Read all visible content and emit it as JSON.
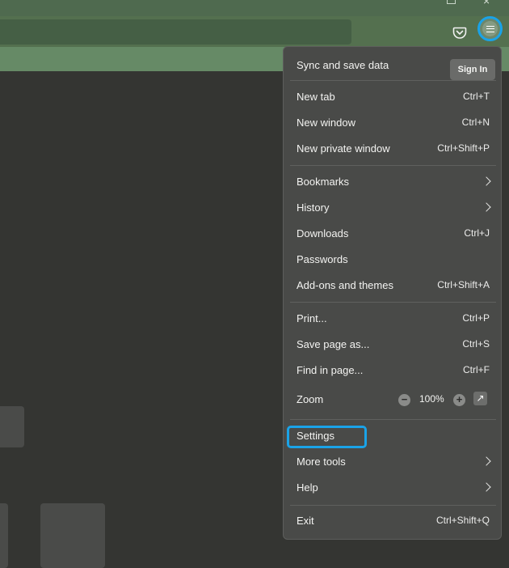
{
  "menu": {
    "sync_label": "Sync and save data",
    "sign_in": "Sign In",
    "items_group1": [
      {
        "label": "New tab",
        "shortcut": "Ctrl+T"
      },
      {
        "label": "New window",
        "shortcut": "Ctrl+N"
      },
      {
        "label": "New private window",
        "shortcut": "Ctrl+Shift+P"
      }
    ],
    "items_group2": [
      {
        "label": "Bookmarks",
        "shortcut": ""
      },
      {
        "label": "History",
        "shortcut": ""
      },
      {
        "label": "Downloads",
        "shortcut": "Ctrl+J"
      },
      {
        "label": "Passwords",
        "shortcut": ""
      },
      {
        "label": "Add-ons and themes",
        "shortcut": "Ctrl+Shift+A"
      }
    ],
    "items_group3": [
      {
        "label": "Print...",
        "shortcut": "Ctrl+P"
      },
      {
        "label": "Save page as...",
        "shortcut": "Ctrl+S"
      },
      {
        "label": "Find in page...",
        "shortcut": "Ctrl+F"
      }
    ],
    "zoom": {
      "label": "Zoom",
      "minus": "−",
      "value": "100%",
      "plus": "+",
      "fullscreen_icon": "↗"
    },
    "items_group4": [
      {
        "label": "Settings",
        "shortcut": ""
      },
      {
        "label": "More tools",
        "shortcut": ""
      },
      {
        "label": "Help",
        "shortcut": ""
      }
    ],
    "exit": {
      "label": "Exit",
      "shortcut": "Ctrl+Shift+Q"
    }
  },
  "chrome": {
    "close_glyph": "×",
    "highlight_color": "#1aa3e8"
  }
}
